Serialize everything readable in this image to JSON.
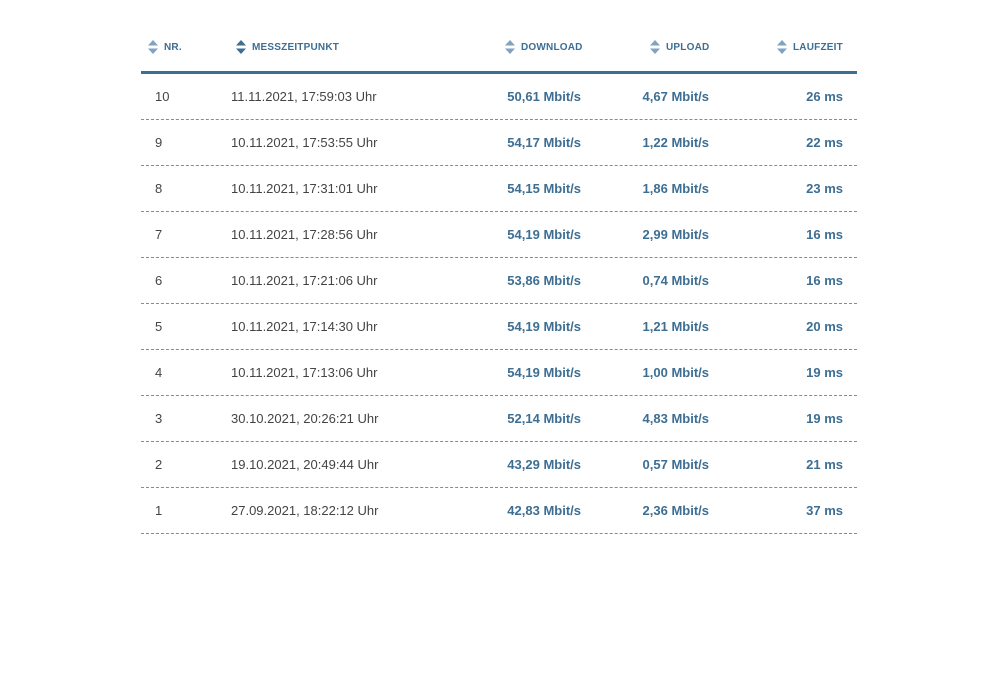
{
  "colors": {
    "accent": "#3d6e93",
    "text": "#444444",
    "divider": "#8a8a8a"
  },
  "icons": {
    "sort": "sort-arrows-icon"
  },
  "table": {
    "headers": {
      "nr": "NR.",
      "time": "MESSZEITPUNKT",
      "download": "DOWNLOAD",
      "upload": "UPLOAD",
      "latency": "LAUFZEIT"
    },
    "rows": [
      {
        "nr": "10",
        "time": "11.11.2021, 17:59:03 Uhr",
        "download": "50,61 Mbit/s",
        "upload": "4,67 Mbit/s",
        "latency": "26 ms"
      },
      {
        "nr": "9",
        "time": "10.11.2021, 17:53:55 Uhr",
        "download": "54,17 Mbit/s",
        "upload": "1,22 Mbit/s",
        "latency": "22 ms"
      },
      {
        "nr": "8",
        "time": "10.11.2021, 17:31:01 Uhr",
        "download": "54,15 Mbit/s",
        "upload": "1,86 Mbit/s",
        "latency": "23 ms"
      },
      {
        "nr": "7",
        "time": "10.11.2021, 17:28:56 Uhr",
        "download": "54,19 Mbit/s",
        "upload": "2,99 Mbit/s",
        "latency": "16 ms"
      },
      {
        "nr": "6",
        "time": "10.11.2021, 17:21:06 Uhr",
        "download": "53,86 Mbit/s",
        "upload": "0,74 Mbit/s",
        "latency": "16 ms"
      },
      {
        "nr": "5",
        "time": "10.11.2021, 17:14:30 Uhr",
        "download": "54,19 Mbit/s",
        "upload": "1,21 Mbit/s",
        "latency": "20 ms"
      },
      {
        "nr": "4",
        "time": "10.11.2021, 17:13:06 Uhr",
        "download": "54,19 Mbit/s",
        "upload": "1,00 Mbit/s",
        "latency": "19 ms"
      },
      {
        "nr": "3",
        "time": "30.10.2021, 20:26:21 Uhr",
        "download": "52,14 Mbit/s",
        "upload": "4,83 Mbit/s",
        "latency": "19 ms"
      },
      {
        "nr": "2",
        "time": "19.10.2021, 20:49:44 Uhr",
        "download": "43,29 Mbit/s",
        "upload": "0,57 Mbit/s",
        "latency": "21 ms"
      },
      {
        "nr": "1",
        "time": "27.09.2021, 18:22:12 Uhr",
        "download": "42,83 Mbit/s",
        "upload": "2,36 Mbit/s",
        "latency": "37 ms"
      }
    ]
  }
}
